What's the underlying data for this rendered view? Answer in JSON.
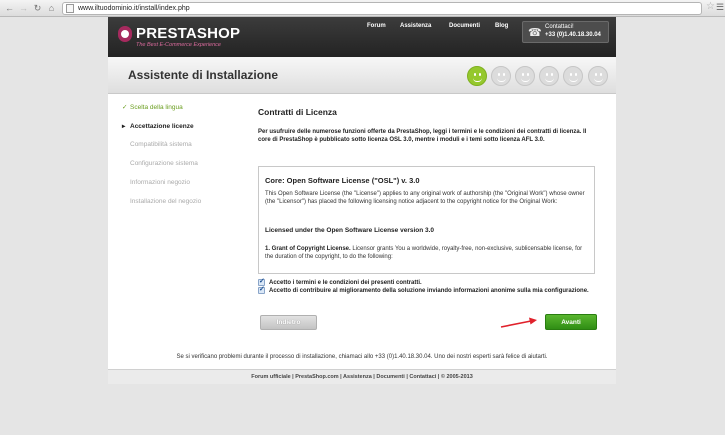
{
  "browser": {
    "url": "www.iltuodominio.it/install/index.php",
    "icons": [
      "back-arrow",
      "forward-arrow",
      "reload",
      "home",
      "page",
      "star",
      "menu"
    ]
  },
  "header": {
    "logo_text": "PRESTASHOP",
    "tagline": "The Best E-Commerce Experience",
    "nav": [
      "Forum",
      "Assistenza",
      "Documenti",
      "Blog"
    ],
    "contact_label": "Contattaci!",
    "contact_phone": "+33 (0)1.40.18.30.04"
  },
  "title": "Assistente di Installazione",
  "progress": {
    "steps_total": 6,
    "steps_active": 1,
    "active_color": "#95c82d"
  },
  "sidebar": {
    "steps": [
      {
        "label": "Scelta della lingua",
        "state": "done"
      },
      {
        "label": "Accettazione licenze",
        "state": "current"
      },
      {
        "label": "Compatibilità sistema",
        "state": "todo"
      },
      {
        "label": "Configurazione sistema",
        "state": "todo"
      },
      {
        "label": "Informazioni negozio",
        "state": "todo"
      },
      {
        "label": "Installazione del negozio",
        "state": "todo"
      }
    ]
  },
  "content": {
    "heading": "Contratti di Licenza",
    "intro": "Per usufruire delle numerose funzioni offerte da PrestaShop, leggi i termini e le condizioni dei contratti di licenza. Il core di PrestaShop è pubblicato sotto licenza OSL 3.0, mentre i moduli e i temi sotto licenza AFL 3.0.",
    "license": {
      "title": "Core: Open Software License (\"OSL\") v. 3.0",
      "paragraph1": "This Open Software License (the \"License\") applies to any original work of authorship (the \"Original Work\") whose owner (the \"Licensor\") has placed the following licensing notice adjacent to the copyright notice for the Original Work:",
      "subtitle": "Licensed under the Open Software License version 3.0",
      "grant_label": "1. Grant of Copyright License.",
      "grant_text": "Licensor grants You a worldwide, royalty-free, non-exclusive, sublicensable license, for the duration of the copyright, to do the following:"
    },
    "checkbox_terms": "Accetto i termini e le condizioni dei presenti contratti.",
    "checkbox_improve": "Accetto di contribuire al miglioramento della soluzione inviando informazioni anonime sulla mia configurazione.",
    "back_label": "Indietro",
    "next_label": "Avanti",
    "help": "Se si verificano problemi durante il processo di installazione, chiamaci allo +33 (0)1.40.18.30.04. Uno dei nostri esperti sarà felice di aiutarti."
  },
  "footer": "Forum ufficiale | PrestaShop.com | Assistenza | Documenti | Contattaci | © 2005-2013",
  "colors": {
    "brand": "#a62a5e",
    "next_button": "#3f9e1e",
    "done_step": "#6a9e1f",
    "annotation_arrow": "#e0212b"
  }
}
